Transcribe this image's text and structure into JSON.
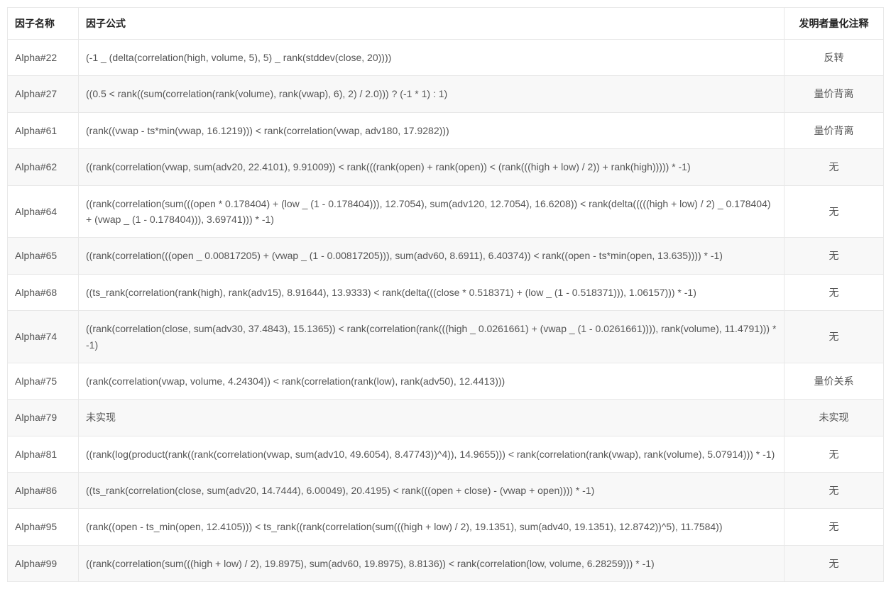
{
  "table": {
    "headers": {
      "name": "因子名称",
      "formula": "因子公式",
      "annotation": "发明者量化注释"
    },
    "rows": [
      {
        "name": "Alpha#22",
        "formula": "(-1 _ (delta(correlation(high, volume, 5), 5) _ rank(stddev(close, 20))))",
        "annotation": "反转"
      },
      {
        "name": "Alpha#27",
        "formula": "((0.5 < rank((sum(correlation(rank(volume), rank(vwap), 6), 2) / 2.0))) ? (-1 * 1) : 1)",
        "annotation": "量价背离"
      },
      {
        "name": "Alpha#61",
        "formula": "(rank((vwap - ts*min(vwap, 16.1219))) < rank(correlation(vwap, adv180, 17.9282)))",
        "annotation": "量价背离"
      },
      {
        "name": "Alpha#62",
        "formula": "((rank(correlation(vwap, sum(adv20, 22.4101), 9.91009)) < rank(((rank(open) + rank(open)) < (rank(((high + low) / 2)) + rank(high))))) * -1)",
        "annotation": "无"
      },
      {
        "name": "Alpha#64",
        "formula": "((rank(correlation(sum(((open * 0.178404) + (low _ (1 - 0.178404))), 12.7054), sum(adv120, 12.7054), 16.6208)) < rank(delta(((((high + low) / 2) _ 0.178404) + (vwap _ (1 - 0.178404))), 3.69741))) * -1)",
        "annotation": "无"
      },
      {
        "name": "Alpha#65",
        "formula": "((rank(correlation(((open _ 0.00817205) + (vwap _ (1 - 0.00817205))), sum(adv60, 8.6911), 6.40374)) < rank((open - ts*min(open, 13.635)))) * -1)",
        "annotation": "无"
      },
      {
        "name": "Alpha#68",
        "formula": "((ts_rank(correlation(rank(high), rank(adv15), 8.91644), 13.9333) < rank(delta(((close * 0.518371) + (low _ (1 - 0.518371))), 1.06157))) * -1)",
        "annotation": "无"
      },
      {
        "name": "Alpha#74",
        "formula": "((rank(correlation(close, sum(adv30, 37.4843), 15.1365)) < rank(correlation(rank(((high _ 0.0261661) + (vwap _ (1 - 0.0261661)))), rank(volume), 11.4791))) * -1)",
        "annotation": "无"
      },
      {
        "name": "Alpha#75",
        "formula": "(rank(correlation(vwap, volume, 4.24304)) < rank(correlation(rank(low), rank(adv50), 12.4413)))",
        "annotation": "量价关系"
      },
      {
        "name": "Alpha#79",
        "formula": "未实现",
        "annotation": "未实现"
      },
      {
        "name": "Alpha#81",
        "formula": "((rank(log(product(rank((rank(correlation(vwap, sum(adv10, 49.6054), 8.47743))^4)), 14.9655))) < rank(correlation(rank(vwap), rank(volume), 5.07914))) * -1)",
        "annotation": "无"
      },
      {
        "name": "Alpha#86",
        "formula": "((ts_rank(correlation(close, sum(adv20, 14.7444), 6.00049), 20.4195) < rank(((open + close) - (vwap + open)))) * -1)",
        "annotation": "无"
      },
      {
        "name": "Alpha#95",
        "formula": "(rank((open - ts_min(open, 12.4105))) < ts_rank((rank(correlation(sum(((high + low) / 2), 19.1351), sum(adv40, 19.1351), 12.8742))^5), 11.7584))",
        "annotation": "无"
      },
      {
        "name": "Alpha#99",
        "formula": "((rank(correlation(sum(((high + low) / 2), 19.8975), sum(adv60, 19.8975), 8.8136)) < rank(correlation(low, volume, 6.28259))) * -1)",
        "annotation": "无"
      }
    ]
  }
}
